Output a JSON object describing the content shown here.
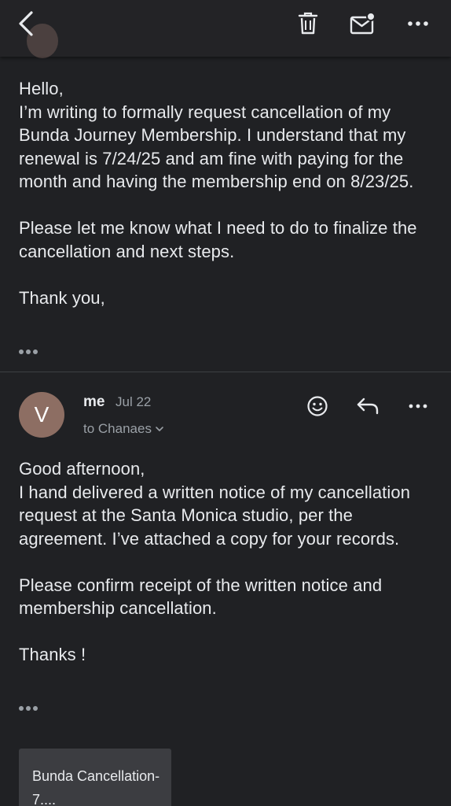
{
  "toolbar": {
    "back_icon": "back-arrow-icon",
    "delete_icon": "trash-icon",
    "mark_unread_icon": "mail-unread-icon",
    "more_icon": "more-horizontal-icon"
  },
  "thread": {
    "message1": {
      "paragraphs": [
        "Hello,",
        "I’m writing to formally request cancellation of my Bunda Journey Membership. I understand that my renewal is 7/24/25 and am fine with paying for the month and having the membership end on 8/23/25.",
        "",
        "Please let me know what I need to do to finalize the cancellation and next steps.",
        "",
        "Thank you,"
      ]
    },
    "message2": {
      "avatar_letter": "V",
      "avatar_color": "#8d6e63",
      "sender": "me",
      "date": "Jul 22",
      "to": "to Chanaes",
      "paragraphs": [
        "Good afternoon,",
        "I hand delivered a written notice of my cancellation request at the Santa Monica studio, per the agreement. I’ve attached a copy for your records.",
        "",
        "Please confirm receipt of the written notice and membership cancellation.",
        "",
        "Thanks !"
      ],
      "attachment": {
        "name": "Bunda Cancellation-7...."
      }
    }
  },
  "colors": {
    "background": "#202124",
    "text": "#e8eaed",
    "secondary_text": "#9aa0a6",
    "attachment_bg": "#3c3d41"
  }
}
